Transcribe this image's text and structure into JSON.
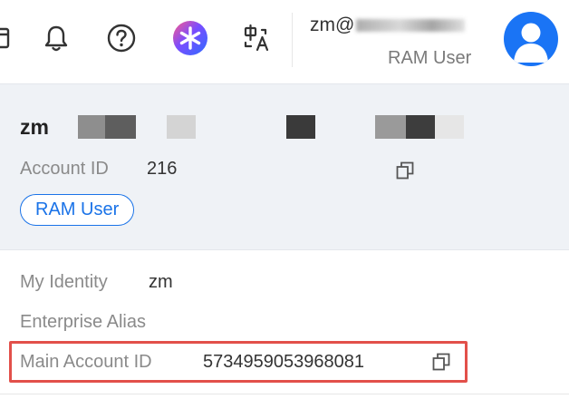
{
  "header": {
    "icons": [
      {
        "name": "window-icon"
      },
      {
        "name": "bell-icon"
      },
      {
        "name": "help-icon"
      },
      {
        "name": "ai-assistant-icon"
      },
      {
        "name": "language-icon"
      }
    ],
    "user": {
      "account_prefix": "zm@",
      "role": "RAM User",
      "avatar_color": "#1a74f5"
    }
  },
  "identity_card": {
    "name": "zm",
    "account_id_label": "Account ID",
    "account_id_value": "216",
    "role_badge": "RAM User",
    "badge_color": "#1a73e8"
  },
  "details": {
    "my_identity_label": "My Identity",
    "my_identity_value": "zm",
    "enterprise_alias_label": "Enterprise Alias",
    "main_account_id_label": "Main Account ID",
    "main_account_id_value": "5734959053968081",
    "highlight_color": "#e2504a"
  }
}
